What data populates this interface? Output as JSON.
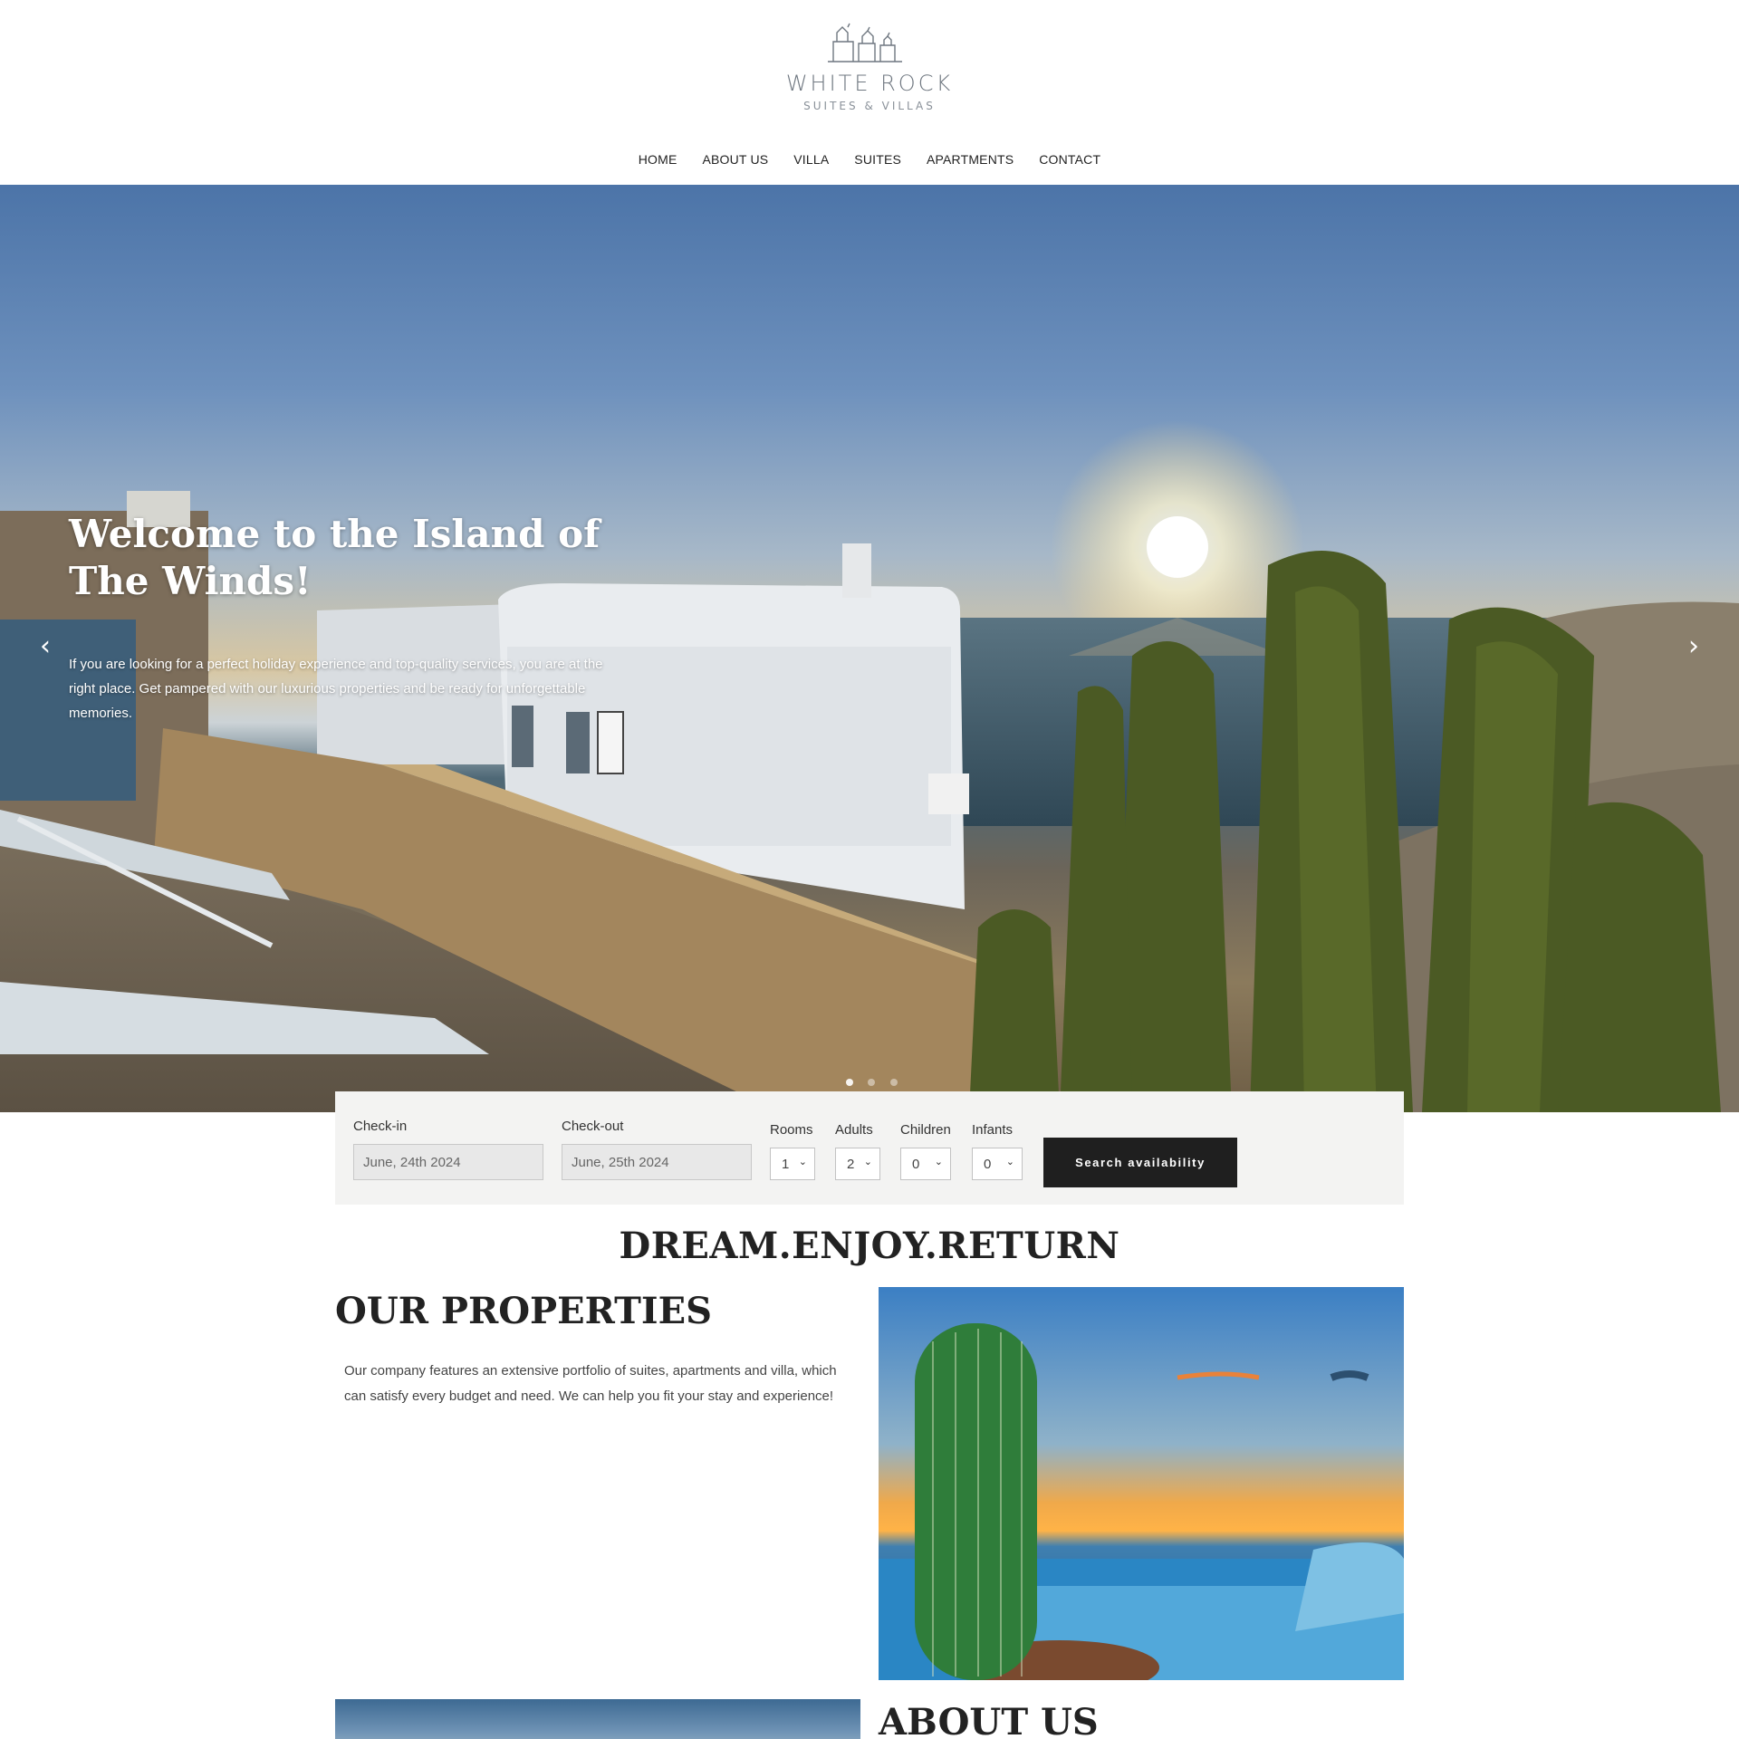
{
  "brand": {
    "title": "WHITE ROCK",
    "subtitle": "SUITES & VILLAS"
  },
  "nav": {
    "items": [
      "HOME",
      "ABOUT US",
      "VILLA",
      "SUITES",
      "APARTMENTS",
      "CONTACT"
    ]
  },
  "hero": {
    "title": "Welcome to the Island of The Winds!",
    "text": "If you are looking for a perfect holiday experience and top-quality services, you are at the right place. Get pampered with our luxurious properties and be ready for unforgettable memories.",
    "prev_icon": "chevron-left-icon",
    "next_icon": "chevron-right-icon",
    "slides": 3,
    "active_slide": 1
  },
  "booking": {
    "checkin_label": "Check-in",
    "checkin_value": "June, 24th 2024",
    "checkout_label": "Check-out",
    "checkout_value": "June, 25th 2024",
    "rooms_label": "Rooms",
    "rooms_value": "1",
    "adults_label": "Adults",
    "adults_value": "2",
    "children_label": "Children",
    "children_value": "0",
    "infants_label": "Infants",
    "infants_value": "0",
    "search_label": "Search availability"
  },
  "content": {
    "tagline": "DREAM.ENJOY.RETURN",
    "properties_heading": "OUR PROPERTIES",
    "properties_text": "Our company features an extensive portfolio of suites, apartments and villa, which can satisfy every budget and need. We can help you fit your stay and experience!",
    "about_heading": "ABOUT US"
  },
  "colors": {
    "button": "#1f1f1f",
    "booking_bg": "#f3f3f2",
    "text": "#222222"
  }
}
